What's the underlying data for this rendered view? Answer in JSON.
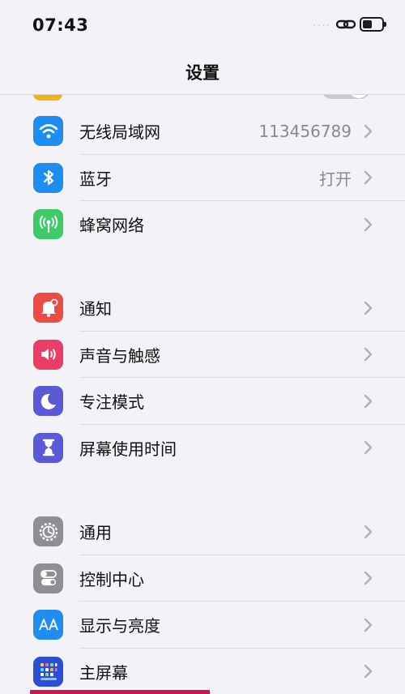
{
  "status_bar": {
    "time": "07:43",
    "dots": "····"
  },
  "nav": {
    "title": "设置"
  },
  "groups": [
    {
      "items": [
        {
          "label": "无线局域网",
          "value": "113456789",
          "icon": "wifi-icon",
          "color": "#1e8cf0"
        },
        {
          "label": "蓝牙",
          "value": "打开",
          "icon": "bluetooth-icon",
          "color": "#1e8cf0"
        },
        {
          "label": "蜂窝网络",
          "value": "",
          "icon": "antenna-icon",
          "color": "#3dca67"
        }
      ]
    },
    {
      "items": [
        {
          "label": "通知",
          "value": "",
          "icon": "bell-icon",
          "color": "#ee4b47"
        },
        {
          "label": "声音与触感",
          "value": "",
          "icon": "speaker-icon",
          "color": "#ea3d68"
        },
        {
          "label": "专注模式",
          "value": "",
          "icon": "moon-icon",
          "color": "#5a5ad6"
        },
        {
          "label": "屏幕使用时间",
          "value": "",
          "icon": "hourglass-icon",
          "color": "#5a5ad6"
        }
      ]
    },
    {
      "items": [
        {
          "label": "通用",
          "value": "",
          "icon": "gear-icon",
          "color": "#8e8e93"
        },
        {
          "label": "控制中心",
          "value": "",
          "icon": "toggles-icon",
          "color": "#8e8e93"
        },
        {
          "label": "显示与亮度",
          "value": "",
          "icon": "text-size-icon",
          "color": "#1e8cf0"
        },
        {
          "label": "主屏幕",
          "value": "",
          "icon": "home-grid-icon",
          "color": "#2a4fd6"
        }
      ]
    }
  ]
}
